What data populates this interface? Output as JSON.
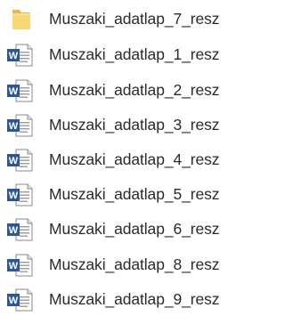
{
  "items": [
    {
      "name": "Muszaki_adatlap_7_resz",
      "type": "folder",
      "icon": "folder-icon"
    },
    {
      "name": "Muszaki_adatlap_1_resz",
      "type": "word-document",
      "icon": "word-document-icon"
    },
    {
      "name": "Muszaki_adatlap_2_resz",
      "type": "word-document",
      "icon": "word-document-icon"
    },
    {
      "name": "Muszaki_adatlap_3_resz",
      "type": "word-document",
      "icon": "word-document-icon"
    },
    {
      "name": "Muszaki_adatlap_4_resz",
      "type": "word-document",
      "icon": "word-document-icon"
    },
    {
      "name": "Muszaki_adatlap_5_resz",
      "type": "word-document",
      "icon": "word-document-icon"
    },
    {
      "name": "Muszaki_adatlap_6_resz",
      "type": "word-document",
      "icon": "word-document-icon"
    },
    {
      "name": "Muszaki_adatlap_8_resz",
      "type": "word-document",
      "icon": "word-document-icon"
    },
    {
      "name": "Muszaki_adatlap_9_resz",
      "type": "word-document",
      "icon": "word-document-icon"
    }
  ],
  "colors": {
    "folder": "#F8D775",
    "folder_dark": "#E8B84A",
    "word_blue": "#2B579A",
    "text": "#2B2B2B"
  }
}
